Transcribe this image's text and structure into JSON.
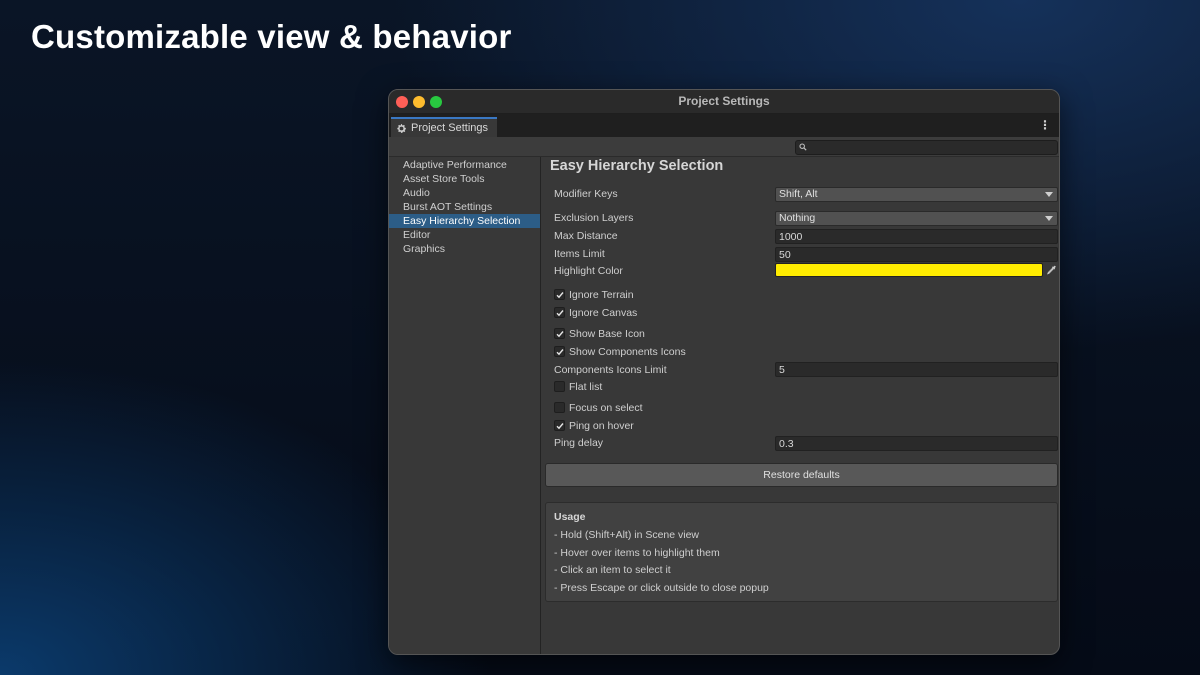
{
  "headline": "Customizable view & behavior",
  "window": {
    "title": "Project Settings",
    "tab_label": "Project Settings",
    "search_placeholder": ""
  },
  "sidebar": {
    "items": [
      {
        "label": "Adaptive Performance",
        "active": false
      },
      {
        "label": "Asset Store Tools",
        "active": false
      },
      {
        "label": "Audio",
        "active": false
      },
      {
        "label": "Burst AOT Settings",
        "active": false
      },
      {
        "label": "Easy Hierarchy Selection",
        "active": true
      },
      {
        "label": "Editor",
        "active": false
      },
      {
        "label": "Graphics",
        "active": false
      }
    ]
  },
  "settings": {
    "title": "Easy Hierarchy Selection",
    "modifier_keys": {
      "label": "Modifier Keys",
      "value": "Shift, Alt"
    },
    "exclusion_layers": {
      "label": "Exclusion Layers",
      "value": "Nothing"
    },
    "max_distance": {
      "label": "Max Distance",
      "value": "1000"
    },
    "items_limit": {
      "label": "Items Limit",
      "value": "50"
    },
    "highlight_color": {
      "label": "Highlight Color",
      "value": "#ffec00"
    },
    "ignore_terrain": {
      "label": "Ignore Terrain",
      "checked": true
    },
    "ignore_canvas": {
      "label": "Ignore Canvas",
      "checked": true
    },
    "show_base_icon": {
      "label": "Show Base Icon",
      "checked": true
    },
    "show_components_icons": {
      "label": "Show Components Icons",
      "checked": true
    },
    "components_icons_limit": {
      "label": "Components Icons Limit",
      "value": "5"
    },
    "flat_list": {
      "label": "Flat list",
      "checked": false
    },
    "focus_on_select": {
      "label": "Focus on select",
      "checked": false
    },
    "ping_on_hover": {
      "label": "Ping on hover",
      "checked": true
    },
    "ping_delay": {
      "label": "Ping delay",
      "value": "0.3"
    },
    "restore_label": "Restore defaults"
  },
  "usage": {
    "title": "Usage",
    "lines": [
      "- Hold (Shift+Alt) in Scene view",
      "- Hover over items to highlight them",
      "- Click an item to select it",
      "- Press Escape or click outside to close popup"
    ]
  },
  "colors": {
    "accent": "#2c5d87",
    "tab_accent": "#3a78c3",
    "highlight": "#ffec00"
  }
}
